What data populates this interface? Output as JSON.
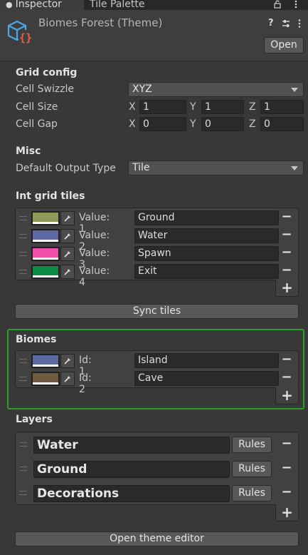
{
  "tabs": {
    "inspector": "Inspector",
    "tile_palette": "Tile Palette"
  },
  "header": {
    "title": "Biomes Forest (Theme)",
    "open_label": "Open"
  },
  "grid_config": {
    "title": "Grid config",
    "cell_swizzle_label": "Cell Swizzle",
    "cell_swizzle_value": "XYZ",
    "cell_size_label": "Cell Size",
    "cell_size": {
      "x": "1",
      "y": "1",
      "z": "1"
    },
    "cell_gap_label": "Cell Gap",
    "cell_gap": {
      "x": "0",
      "y": "0",
      "z": "0"
    },
    "axis_x": "X",
    "axis_y": "Y",
    "axis_z": "Z"
  },
  "misc": {
    "title": "Misc",
    "default_output_type_label": "Default Output Type",
    "default_output_type_value": "Tile"
  },
  "int_grid_tiles": {
    "title": "Int grid tiles",
    "items": [
      {
        "label": "Value: 1",
        "name": "Ground",
        "color": "#8f9a5a"
      },
      {
        "label": "Value: 2",
        "name": "Water",
        "color": "#5d6aa6"
      },
      {
        "label": "Value: 3",
        "name": "Spawn",
        "color": "#f04fa9"
      },
      {
        "label": "Value: 4",
        "name": "Exit",
        "color": "#0e8a47"
      }
    ],
    "sync_label": "Sync tiles"
  },
  "biomes": {
    "title": "Biomes",
    "highlight_color": "#2c9c28",
    "items": [
      {
        "label": "Id: 1",
        "name": "Island",
        "color": "#5c6aa2"
      },
      {
        "label": "Id: 2",
        "name": "Cave",
        "color": "#705a3f"
      }
    ]
  },
  "layers": {
    "title": "Layers",
    "items": [
      {
        "name": "Water",
        "rules_label": "Rules"
      },
      {
        "name": "Ground",
        "rules_label": "Rules"
      },
      {
        "name": "Decorations",
        "rules_label": "Rules"
      }
    ],
    "open_theme_editor_label": "Open theme editor"
  },
  "symbols": {
    "minus": "−",
    "plus": "+",
    "help": "?"
  }
}
